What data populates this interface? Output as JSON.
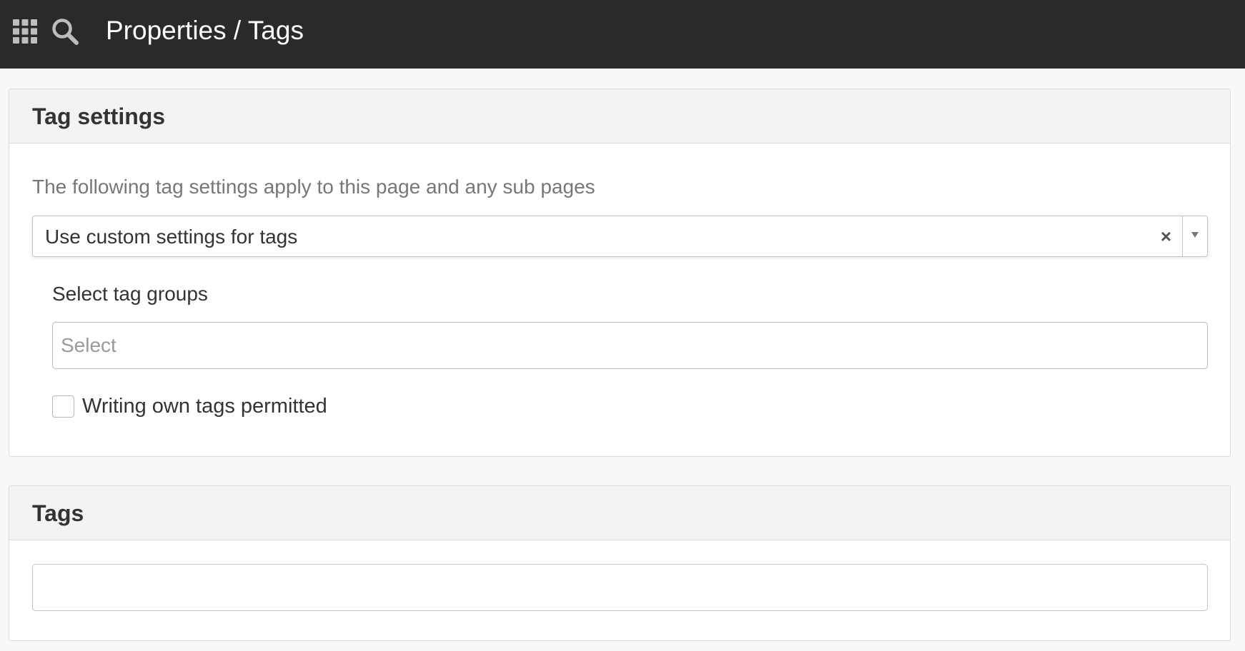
{
  "header": {
    "title": "Properties / Tags",
    "apps_icon": "grid-apps-icon",
    "search_icon": "search-icon",
    "background_color": "#2a2a2a"
  },
  "tag_settings": {
    "title": "Tag settings",
    "description": "The following tag settings apply to this page and any sub pages",
    "mode_select": {
      "selected_value": "Use custom settings for tags",
      "clear_icon": "×",
      "dropdown_icon": "caret-down-icon"
    },
    "tag_groups": {
      "label": "Select tag groups",
      "value": "",
      "placeholder": "Select"
    },
    "own_tags_checkbox": {
      "label": "Writing own tags permitted",
      "checked": false
    }
  },
  "tags": {
    "title": "Tags",
    "input_value": "",
    "input_placeholder": ""
  }
}
